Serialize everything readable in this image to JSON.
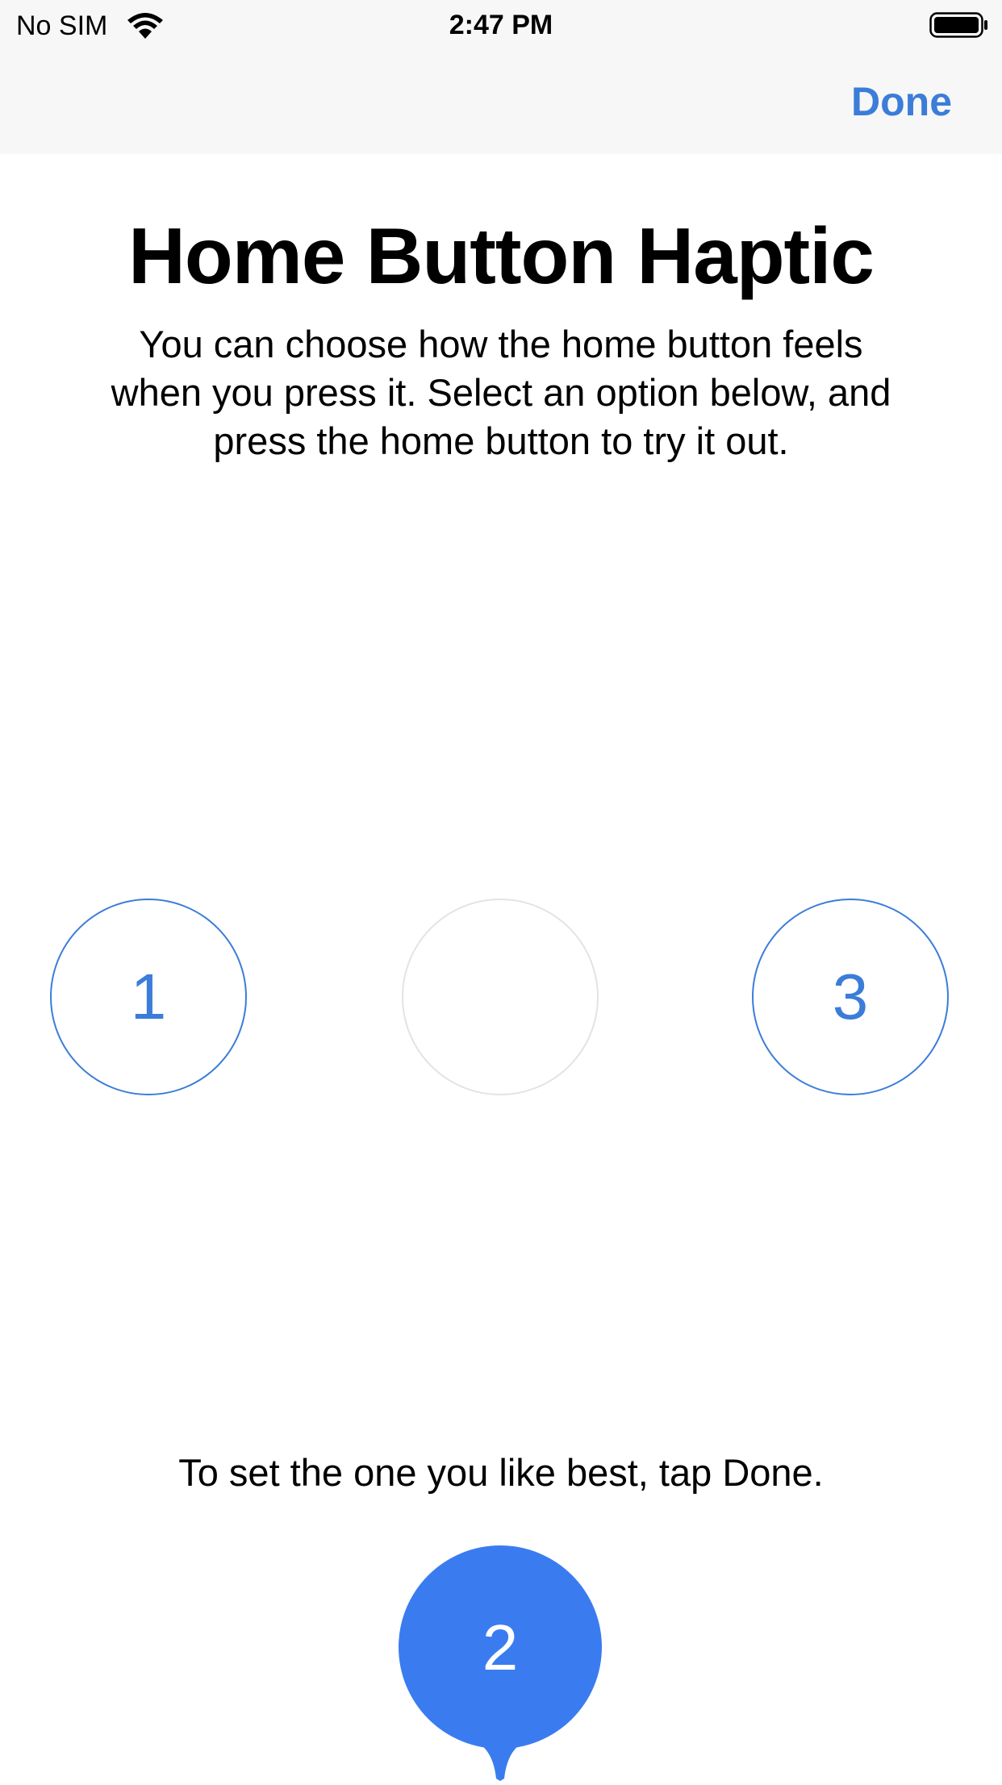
{
  "status_bar": {
    "carrier": "No SIM",
    "time": "2:47 PM",
    "wifi_icon": "wifi-icon",
    "battery_icon": "battery-icon"
  },
  "nav": {
    "done_label": "Done"
  },
  "title": "Home Button Haptic",
  "description": "You can choose how the home button feels when you press it. Select an option below, and press the home button to try it out.",
  "options": [
    {
      "label": "1"
    },
    {
      "label": ""
    },
    {
      "label": "3"
    }
  ],
  "selected": {
    "label": "2"
  },
  "hint": "To set the one you like best, tap Done.",
  "colors": {
    "accent": "#3b7dd8",
    "bubble": "#3a7cf0",
    "bar": "#f7f7f7",
    "empty_circle_border": "#e3e3e3"
  }
}
